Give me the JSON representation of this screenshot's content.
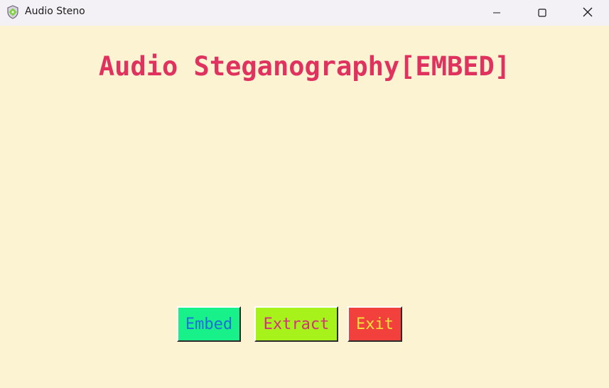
{
  "window": {
    "title": "Audio Steno",
    "icon": "shield-gear-icon",
    "controls": {
      "minimize": "minimize-icon",
      "maximize": "maximize-icon",
      "close": "close-icon"
    }
  },
  "main": {
    "heading": "Audio Steganography[EMBED]",
    "buttons": {
      "embed": "Embed",
      "extract": "Extract",
      "exit": "Exit"
    }
  },
  "colors": {
    "background": "#fcf3d2",
    "heading": "#e0325f",
    "embed_bg": "#18f08a",
    "embed_fg": "#1e6fd8",
    "extract_bg": "#a6f21a",
    "extract_fg": "#d4327a",
    "exit_bg": "#f2403c",
    "exit_fg": "#f5e23a"
  }
}
